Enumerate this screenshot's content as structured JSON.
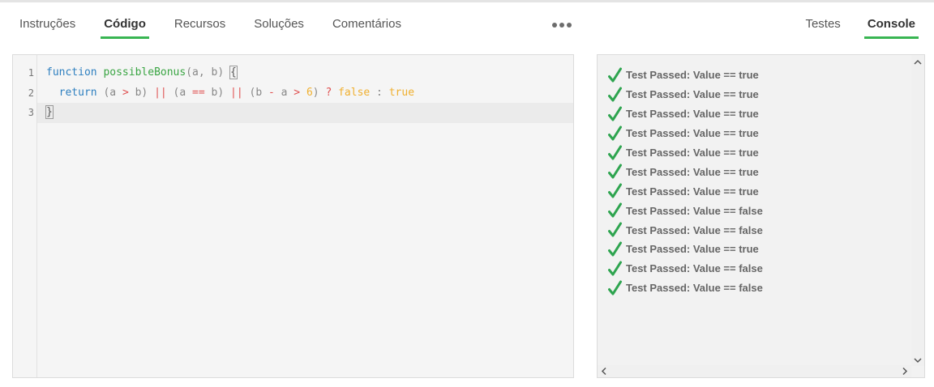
{
  "tabs_left": [
    {
      "label": "Instruções",
      "active": false
    },
    {
      "label": "Código",
      "active": true
    },
    {
      "label": "Recursos",
      "active": false
    },
    {
      "label": "Soluções",
      "active": false
    },
    {
      "label": "Comentários",
      "active": false
    }
  ],
  "more_icon": "more-horizontal-icon",
  "tabs_right": [
    {
      "label": "Testes",
      "active": false
    },
    {
      "label": "Console",
      "active": true
    }
  ],
  "editor": {
    "lines": [
      {
        "number": "1",
        "tokens": [
          {
            "t": "function",
            "c": "kw"
          },
          {
            "t": " ",
            "c": ""
          },
          {
            "t": "possibleBonus",
            "c": "fn"
          },
          {
            "t": "(a, b) ",
            "c": "id"
          },
          {
            "t": "{",
            "c": "bracket"
          }
        ]
      },
      {
        "number": "2",
        "tokens": [
          {
            "t": "  return",
            "c": "kw"
          },
          {
            "t": " (a ",
            "c": "id"
          },
          {
            "t": ">",
            "c": "op"
          },
          {
            "t": " b) ",
            "c": "id"
          },
          {
            "t": "||",
            "c": "op"
          },
          {
            "t": " (a ",
            "c": "id"
          },
          {
            "t": "==",
            "c": "op"
          },
          {
            "t": " b) ",
            "c": "id"
          },
          {
            "t": "||",
            "c": "op"
          },
          {
            "t": " (b ",
            "c": "id"
          },
          {
            "t": "-",
            "c": "op"
          },
          {
            "t": " a ",
            "c": "id"
          },
          {
            "t": ">",
            "c": "op"
          },
          {
            "t": " ",
            "c": "id"
          },
          {
            "t": "6",
            "c": "lit"
          },
          {
            "t": ") ",
            "c": "id"
          },
          {
            "t": "?",
            "c": "op"
          },
          {
            "t": " ",
            "c": ""
          },
          {
            "t": "false",
            "c": "lit"
          },
          {
            "t": " : ",
            "c": "id"
          },
          {
            "t": "true",
            "c": "lit"
          }
        ]
      },
      {
        "number": "3",
        "tokens": [
          {
            "t": "}",
            "c": "bracket"
          }
        ],
        "current": true
      }
    ]
  },
  "console": {
    "check_color": "#2ea44f",
    "results": [
      "Test Passed: Value == true",
      "Test Passed: Value == true",
      "Test Passed: Value == true",
      "Test Passed: Value == true",
      "Test Passed: Value == true",
      "Test Passed: Value == true",
      "Test Passed: Value == true",
      "Test Passed: Value == false",
      "Test Passed: Value == false",
      "Test Passed: Value == true",
      "Test Passed: Value == false",
      "Test Passed: Value == false"
    ]
  }
}
